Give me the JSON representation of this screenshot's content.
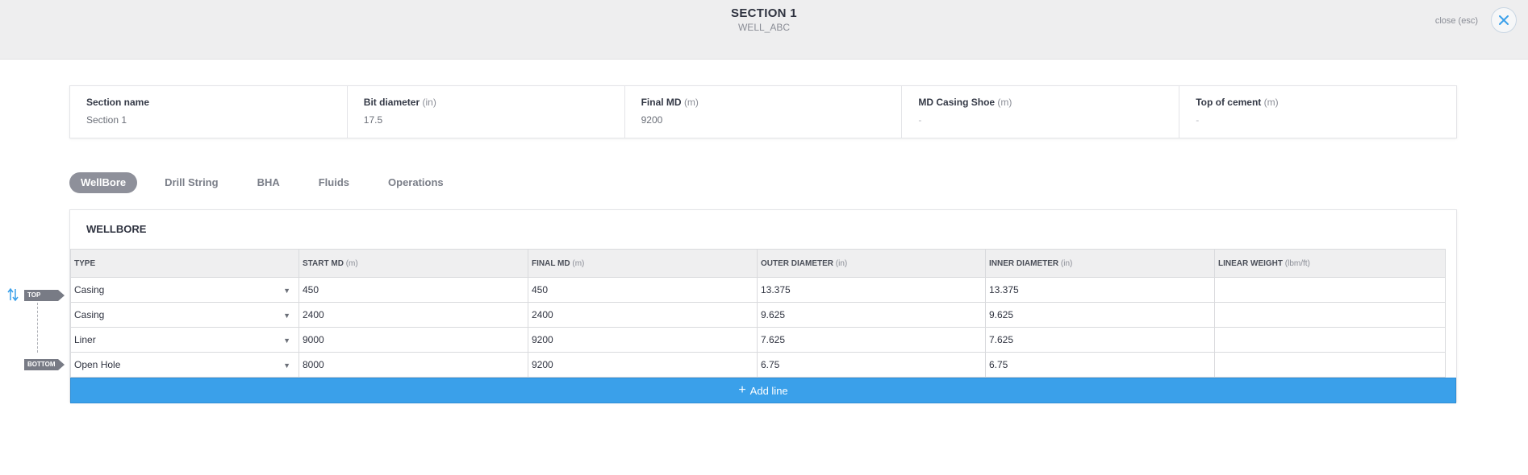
{
  "header": {
    "title": "SECTION 1",
    "subtitle": "WELL_ABC",
    "close_label": "close (esc)"
  },
  "summary": [
    {
      "label": "Section name",
      "unit": "",
      "value": "Section 1"
    },
    {
      "label": "Bit diameter",
      "unit": "(in)",
      "value": "17.5"
    },
    {
      "label": "Final MD",
      "unit": "(m)",
      "value": "9200"
    },
    {
      "label": "MD Casing Shoe",
      "unit": "(m)",
      "value": "-"
    },
    {
      "label": "Top of cement",
      "unit": "(m)",
      "value": "-"
    }
  ],
  "tabs": [
    {
      "label": "WellBore",
      "active": true
    },
    {
      "label": "Drill String",
      "active": false
    },
    {
      "label": "BHA",
      "active": false
    },
    {
      "label": "Fluids",
      "active": false
    },
    {
      "label": "Operations",
      "active": false
    }
  ],
  "wellbore": {
    "title": "WELLBORE",
    "columns": [
      {
        "label": "TYPE",
        "unit": ""
      },
      {
        "label": "START MD",
        "unit": "(m)"
      },
      {
        "label": "FINAL MD",
        "unit": "(m)"
      },
      {
        "label": "OUTER DIAMETER",
        "unit": "(in)"
      },
      {
        "label": "INNER DIAMETER",
        "unit": "(in)"
      },
      {
        "label": "LINEAR WEIGHT",
        "unit": "(lbm/ft)"
      }
    ],
    "rows": [
      [
        "Casing",
        "450",
        "450",
        "13.375",
        "13.375",
        ""
      ],
      [
        "Casing",
        "2400",
        "2400",
        "9.625",
        "9.625",
        ""
      ],
      [
        "Liner",
        "9000",
        "9200",
        "7.625",
        "7.625",
        ""
      ],
      [
        "Open Hole",
        "8000",
        "9200",
        "6.75",
        "6.75",
        ""
      ]
    ],
    "add_line_label": "Add line"
  },
  "side": {
    "top_label": "TOP",
    "bottom_label": "BOTTOM"
  },
  "colors": {
    "accent": "#3aa0ea",
    "tab_active": "#8e909a"
  }
}
